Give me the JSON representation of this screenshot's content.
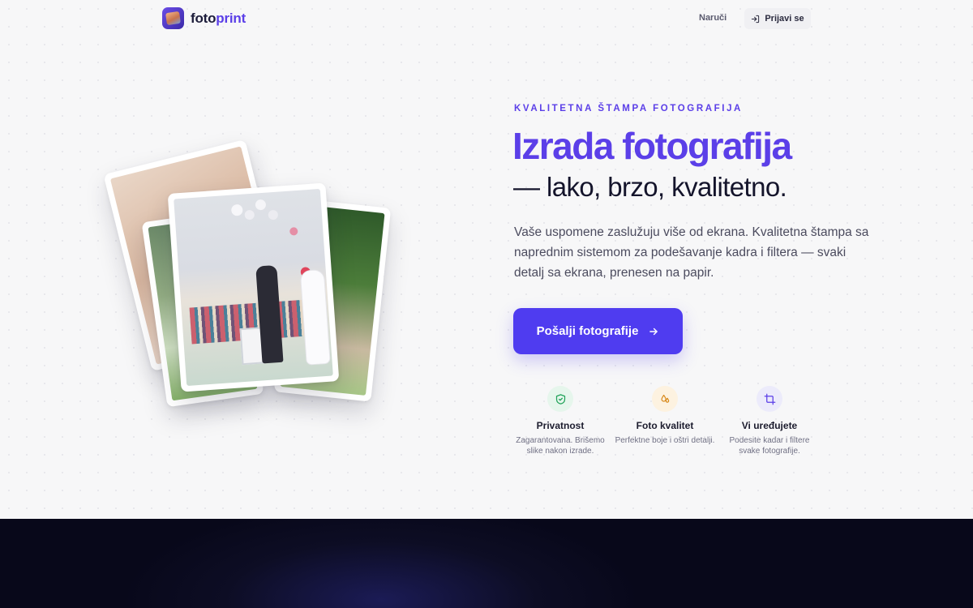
{
  "header": {
    "logo_part1": "foto",
    "logo_part2": "print",
    "nav_order": "Naruči",
    "login": "Prijavi se"
  },
  "hero": {
    "eyebrow": "KVALITETNA ŠTAMPA FOTOGRAFIJA",
    "title": "Izrada fotografija",
    "subtitle": "— lako, brzo, kvalitetno.",
    "description": "Vaše uspomene zaslužuju više od ekrana. Kvalitetna štampa sa naprednim sistemom za podešavanje kadra i filtera — svaki detalj sa ekrana, prenesen na papir.",
    "cta": "Pošalji fotografije"
  },
  "features": [
    {
      "title": "Privatnost",
      "desc": "Zagarantovana. Brišemo slike nakon izrade.",
      "icon": "shield-check-icon",
      "color": "#22a35a",
      "bg": "#e6f6ec"
    },
    {
      "title": "Foto kvalitet",
      "desc": "Perfektne boje i oštri detalji.",
      "icon": "drops-icon",
      "color": "#d88a1c",
      "bg": "#fdf2e0"
    },
    {
      "title": "Vi uređujete",
      "desc": "Podesite kadar i filtere svake fotografije.",
      "icon": "crop-icon",
      "color": "#5b3fe8",
      "bg": "#ecebfb"
    }
  ],
  "colors": {
    "accent": "#5b3fe8",
    "cta": "#4f3cf0",
    "dark_section": "#0d0d24"
  }
}
